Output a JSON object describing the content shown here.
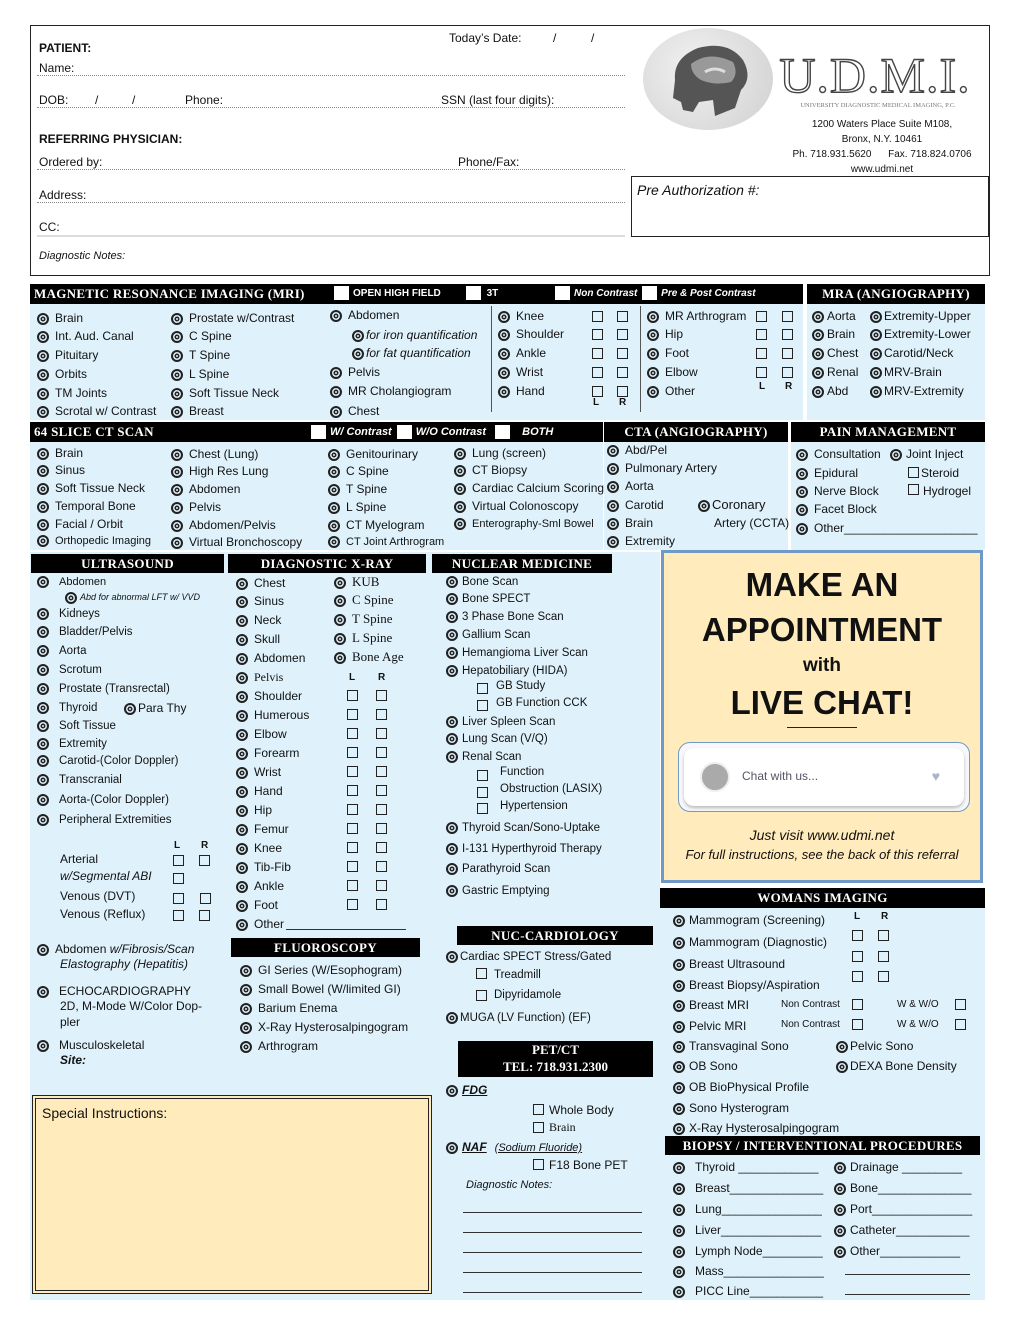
{
  "header": {
    "todays_date_label": "Today’s Date:",
    "date_slash": "/",
    "patient_label": "PATIENT:",
    "name_label": "Name:",
    "dob_label": "DOB:",
    "phone_label": "Phone:",
    "ssn_label": "SSN (last four digits):",
    "referring_label": "REFERRING PHYSICIAN:",
    "ordered_by_label": "Ordered by:",
    "phone_fax_label": "Phone/Fax:",
    "address_label": "Address:",
    "cc_label": "CC:",
    "diagnostic_notes_label": "Diagnostic Notes:"
  },
  "brand": {
    "logo_text": "U.D.M.I.",
    "full_name": "UNIVERSITY DIAGNOSTIC MEDICAL IMAGING, P.C.",
    "address_line1": "1200 Waters Place Suite M108,",
    "address_line2": "Bronx, N.Y. 10461",
    "phone": "Ph. 718.931.5620",
    "fax": "Fax. 718.824.0706",
    "website": "www.udmi.net",
    "pre_auth_label": "Pre Authorization #:"
  },
  "mri": {
    "title": "Magnetic Resonance Imaging (MRI)",
    "options": [
      "OPEN HIGH FIELD",
      "3T",
      "Non Contrast",
      "Pre & Post Contrast"
    ],
    "col1": [
      "Brain",
      "Int. Aud. Canal",
      "Pituitary",
      "Orbits",
      "TM Joints",
      "Scrotal w/ Contrast"
    ],
    "col2": [
      "Prostate w/Contrast",
      "C Spine",
      "T Spine",
      "L Spine",
      "Soft Tissue Neck",
      "Breast"
    ],
    "col3_abdomen": "Abdomen",
    "col3_sub": [
      "for iron quantification",
      "for fat quantification"
    ],
    "col3": [
      "Pelvis",
      "MR Cholangiogram",
      "Chest"
    ],
    "col4": [
      "Knee",
      "Shoulder",
      "Ankle",
      "Wrist",
      "Hand"
    ],
    "col5": [
      "MR Arthrogram",
      "Hip",
      "Foot",
      "Elbow",
      "Other"
    ],
    "l_label": "L",
    "r_label": "R"
  },
  "mra": {
    "title": "MRA (Angiography)",
    "col1": [
      "Aorta",
      "Brain",
      "Chest",
      "Renal",
      "Abd"
    ],
    "col2": [
      "Extremity-Upper",
      "Extremity-Lower",
      "Carotid/Neck",
      "MRV-Brain",
      "MRV-Extremity"
    ]
  },
  "ct": {
    "title": "64 Slice CT Scan",
    "options": [
      "W/ Contrast",
      "W/O Contrast",
      "BOTH"
    ],
    "col1": [
      "Brain",
      "Sinus",
      "Soft Tissue Neck",
      "Temporal Bone",
      "Facial / Orbit",
      "Orthopedic Imaging"
    ],
    "col2": [
      "Chest (Lung)",
      "High Res Lung",
      "Abdomen",
      "Pelvis",
      "Abdomen/Pelvis",
      "Virtual Bronchoscopy"
    ],
    "col3": [
      "Genitourinary",
      "C Spine",
      "T Spine",
      "L Spine",
      "CT Myelogram",
      "CT Joint Arthrogram"
    ],
    "col4": [
      "Lung (screen)",
      "CT Biopsy",
      "Cardiac Calcium Scoring",
      "Virtual Colonoscopy",
      "Enterography-Sml Bowel"
    ]
  },
  "cta": {
    "title": "CTA (Angiography)",
    "items": [
      "Abd/Pel",
      "Pulmonary Artery",
      "Aorta",
      "Carotid",
      "Brain",
      "Extremity"
    ],
    "coronary_line1": "Coronary",
    "coronary_line2": "Artery (CCTA)"
  },
  "pain": {
    "title": "Pain Management",
    "items": [
      "Consultation",
      "Epidural",
      "Nerve Block",
      "Facet Block",
      "Other____________________"
    ],
    "joint_inject": "Joint Inject",
    "sub": [
      "Steroid",
      "Hydrogel"
    ]
  },
  "ultrasound": {
    "title": "Ultrasound",
    "abdomen": "Abdomen",
    "abd_sub": "Abd for abnormal LFT w/ VVD",
    "items": [
      "Kidneys",
      "Bladder/Pelvis",
      "Aorta",
      "Scrotum",
      "Prostate (Transrectal)",
      "Thyroid",
      "Soft Tissue",
      "Extremity",
      "Carotid-(Color Doppler)",
      "Transcranial",
      "Aorta-(Color Doppler)",
      "Peripheral Extremities"
    ],
    "para_thy": "Para Thy",
    "l_label": "L",
    "r_label": "R",
    "vascular": [
      "Arterial",
      "w/Segmental ABI",
      "Venous  (DVT)",
      "Venous  (Reflux)"
    ],
    "fibrosis_line1_a": "Abdomen ",
    "fibrosis_line1_b": "w/Fibrosis/Scan",
    "fibrosis_line2": "Elastography (Hepatitis)",
    "echo_line1": "ECHOCARDIOGRAPHY",
    "echo_line2": "2D, M-Mode W/Color Dop-",
    "echo_line3": "pler",
    "msk": "Musculoskeletal",
    "site": "Site:"
  },
  "xray": {
    "title": "Diagnostic  X-Ray",
    "col1": [
      "Chest",
      "Sinus",
      "Neck",
      "Skull",
      "Abdomen",
      "Pelvis"
    ],
    "col2": [
      "KUB",
      "C Spine",
      "T Spine",
      "L Spine",
      "Bone Age"
    ],
    "lr_items": [
      "Shoulder",
      "Humerous",
      "Elbow",
      "Forearm",
      "Wrist",
      "Hand",
      "Hip",
      "Femur",
      "Knee",
      "Tib-Fib",
      "Ankle",
      "Foot"
    ],
    "other": "Other",
    "l_label": "L",
    "r_label": "R"
  },
  "fluoro": {
    "title": "Fluoroscopy",
    "items": [
      "GI Series (W/Esophogram)",
      "Small Bowel (W/limited GI)",
      "Barium Enema",
      "X-Ray Hysterosalpingogram",
      "Arthrogram"
    ]
  },
  "nuclear": {
    "title": "Nuclear Medicine",
    "items_a": [
      "Bone Scan",
      "Bone SPECT",
      "3 Phase Bone Scan",
      "Gallium Scan",
      "Hemangioma Liver Scan",
      "Hepatobiliary (HIDA)"
    ],
    "hida_sub": [
      "GB Study",
      "GB Function CCK"
    ],
    "items_b": [
      "Liver Spleen Scan",
      "Lung Scan (V/Q)",
      "Renal Scan"
    ],
    "renal_sub": [
      "Function",
      "Obstruction (LASIX)",
      "Hypertension"
    ],
    "items_c": [
      "Thyroid Scan/Sono-Uptake",
      "I-131 Hyperthyroid Therapy",
      "Parathyroid Scan",
      "Gastric Emptying"
    ]
  },
  "nuc_cardio": {
    "title": "Nuc-Cardiology",
    "spect": "Cardiac SPECT Stress/Gated",
    "sub": [
      "Treadmill",
      "Dipyridamole"
    ],
    "muga": "MUGA (LV Function) (EF)"
  },
  "pet": {
    "title_line1": "PET/CT",
    "title_line2": "TEL: 718.931.2300",
    "fdg": "FDG",
    "fdg_sub": [
      "Whole Body",
      "Brain"
    ],
    "naf": "NAF",
    "naf_note": "(Sodium Fluoride)",
    "naf_sub": "F18 Bone PET",
    "notes_label": "Diagnostic Notes:"
  },
  "promo": {
    "line1": "MAKE AN",
    "line2": "APPOINTMENT",
    "line3": "with",
    "line4": "LIVE CHAT!",
    "chat_placeholder": "Chat with us...",
    "visit": "Just visit www.udmi.net",
    "instructions": "For full instructions, see the back of this referral"
  },
  "womans": {
    "title": "Womans Imaging",
    "items": [
      "Mammogram (Screening)",
      "Mammogram (Diagnostic)",
      "Breast Ultrasound",
      "Breast Biopsy/Aspiration",
      "Breast MRI",
      "Pelvic MRI",
      "Transvaginal Sono",
      "OB Sono",
      "OB  BioPhysical Profile",
      "Sono Hysterogram",
      "X-Ray Hysterosalpingogram"
    ],
    "right_items": [
      "Pelvic Sono",
      "DEXA Bone Density"
    ],
    "non_contrast": "Non Contrast",
    "w_wo": "W & W/O",
    "l_label": "L",
    "r_label": "R"
  },
  "biopsy": {
    "title": "Biopsy / Interventional Procedures",
    "col1": [
      "Thyroid ____________",
      "Breast______________",
      "Lung_______________",
      "Liver_______________",
      "Lymph Node_________",
      "Mass_______________",
      "PICC Line___________"
    ],
    "col2": [
      "Drainage _________",
      "Bone______________",
      "Port_______________",
      "Catheter___________",
      "Other____________"
    ]
  },
  "special": {
    "label": "Special Instructions:"
  },
  "colors": {
    "panel_bg": "#dff2fc",
    "header_bg": "#000000",
    "promo_bg": "#ffebbb",
    "promo_border": "#6f9ac8"
  }
}
